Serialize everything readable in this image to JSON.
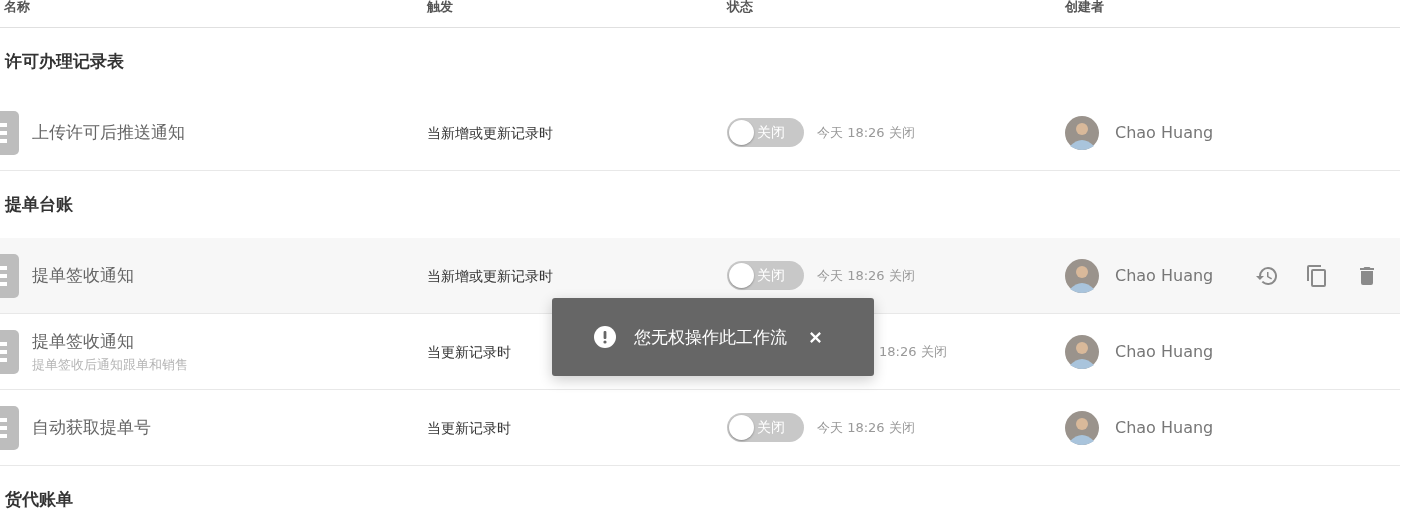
{
  "columns": [
    "名称",
    "触发",
    "状态",
    "创建者"
  ],
  "groups": [
    {
      "title": "许可办理记录表",
      "rows": [
        {
          "name": "上传许可后推送通知",
          "trigger": "当新增或更新记录时",
          "on": false,
          "toggle_label": "关闭",
          "status_time": "今天 18:26 关闭",
          "creator": "Chao Huang",
          "hovered": false
        }
      ]
    },
    {
      "title": "提单台账",
      "rows": [
        {
          "name": "提单签收通知",
          "trigger": "当新增或更新记录时",
          "on": false,
          "toggle_label": "关闭",
          "status_time": "今天 18:26 关闭",
          "creator": "Chao Huang",
          "hovered": true
        },
        {
          "name": "提单签收通知",
          "description": "提单签收后通知跟单和销售",
          "trigger": "当更新记录时",
          "status_time": "18:26 关闭",
          "creator": "Chao Huang",
          "hovered": false
        },
        {
          "name": "自动获取提单号",
          "trigger": "当更新记录时",
          "on": false,
          "toggle_label": "关闭",
          "status_time": "今天 18:26 关闭",
          "creator": "Chao Huang",
          "hovered": false
        }
      ]
    },
    {
      "title": "货代账单"
    }
  ],
  "toast": {
    "message": "您无权操作此工作流"
  }
}
